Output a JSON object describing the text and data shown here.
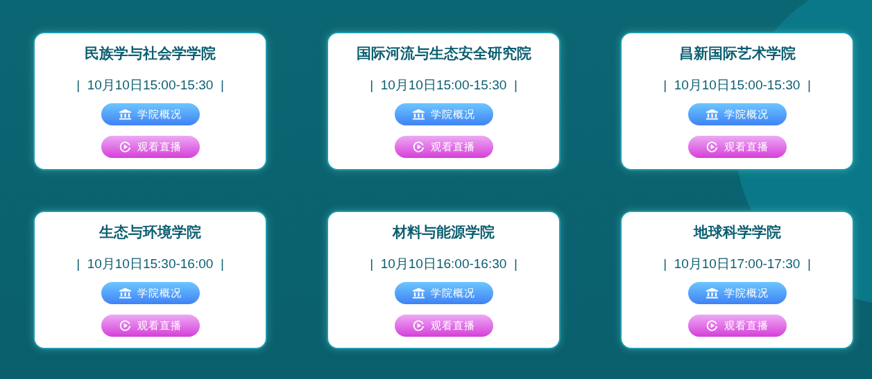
{
  "cards": [
    {
      "title": "民族学与社会学学院",
      "time": "|  10月10日15:00-15:30  |",
      "buttons": [
        {
          "kind": "overview",
          "label": "学院概况"
        },
        {
          "kind": "live",
          "label": "观看直播"
        }
      ]
    },
    {
      "title": "国际河流与生态安全研究院",
      "time": "|  10月10日15:00-15:30  |",
      "buttons": [
        {
          "kind": "overview",
          "label": "学院概况"
        },
        {
          "kind": "live",
          "label": "观看直播"
        }
      ]
    },
    {
      "title": "昌新国际艺术学院",
      "time": "|  10月10日15:00-15:30  |",
      "buttons": [
        {
          "kind": "overview",
          "label": "学院概况"
        },
        {
          "kind": "live",
          "label": "观看直播"
        }
      ]
    },
    {
      "title": "生态与环境学院",
      "time": "|  10月10日15:30-16:00  |",
      "buttons": [
        {
          "kind": "overview",
          "label": "学院概况"
        },
        {
          "kind": "live",
          "label": "观看直播"
        }
      ]
    },
    {
      "title": "材料与能源学院",
      "time": "|  10月10日16:00-16:30  |",
      "buttons": [
        {
          "kind": "overview",
          "label": "学院概况"
        },
        {
          "kind": "live",
          "label": "观看直播"
        }
      ]
    },
    {
      "title": "地球科学学院",
      "time": "|  10月10日17:00-17:30  |",
      "buttons": [
        {
          "kind": "overview",
          "label": "学院概况"
        },
        {
          "kind": "live",
          "label": "观看直播"
        }
      ]
    }
  ]
}
